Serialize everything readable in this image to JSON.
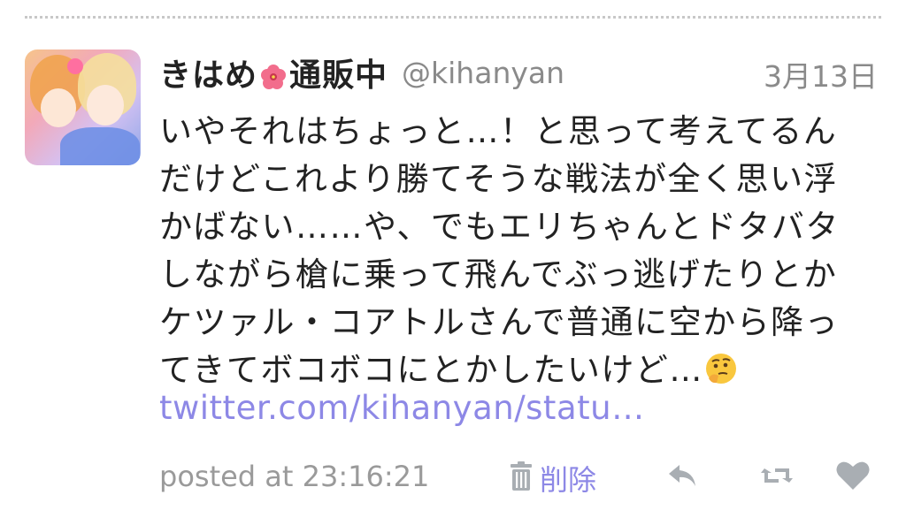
{
  "tweet": {
    "author_name_part1": "きはめ",
    "author_name_part2": "通販中",
    "handle": "@kihanyan",
    "date": "3月13日",
    "body_lines": [
      "いやそれはちょっと…！と思って考えてるん",
      "だけどこれより勝てそうな戦法が全く思い浮",
      "かばない……や、でもエリちゃんとドタバタ",
      "しながら槍に乗って飛んでぶっ逃げたりとか",
      "ケツァル・コアトルさんで普通に空から降っ",
      "てきてボコボコにとかしたいけど…"
    ],
    "link_text": "twitter.com/kihanyan/statu…",
    "posted_at": "posted at 23:16:21",
    "delete_label": "削除"
  },
  "icons": {
    "flower": "hibiscus-emoji",
    "thinking": "thinking-face-emoji",
    "trash": "trash-icon",
    "reply": "reply-icon",
    "retweet": "retweet-icon",
    "like": "heart-icon"
  },
  "colors": {
    "link": "#8d88e6",
    "meta": "#8a8a8a",
    "text": "#222222",
    "icon": "#a9aeb3"
  }
}
